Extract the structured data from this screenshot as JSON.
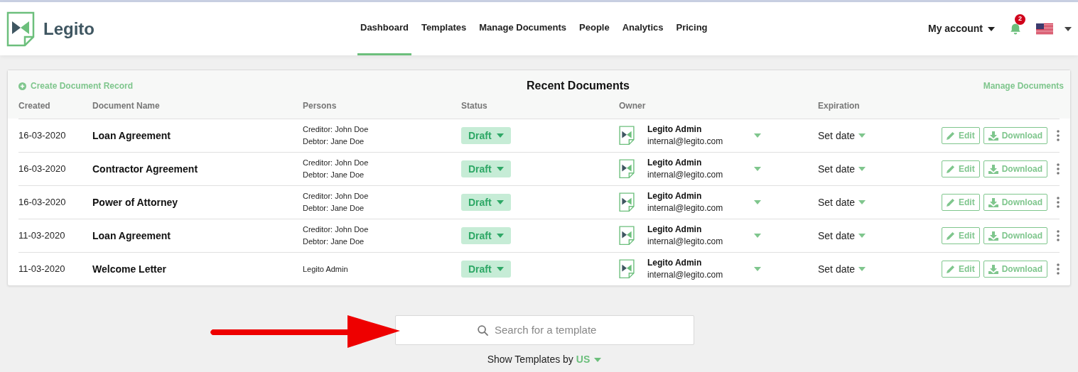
{
  "header": {
    "brand": "Legito",
    "nav": [
      {
        "label": "Dashboard",
        "selected": true
      },
      {
        "label": "Templates",
        "selected": false
      },
      {
        "label": "Manage Documents",
        "selected": false
      },
      {
        "label": "People",
        "selected": false
      },
      {
        "label": "Analytics",
        "selected": false
      },
      {
        "label": "Pricing",
        "selected": false
      }
    ],
    "account": "My account",
    "notifications": "2"
  },
  "recent": {
    "create_link": "Create Document Record",
    "title": "Recent Documents",
    "manage_link": "Manage Documents",
    "columns": [
      "Created",
      "Document Name",
      "Persons",
      "Status",
      "Owner",
      "Expiration"
    ],
    "rows": [
      {
        "created": "16-03-2020",
        "name": "Loan Agreement",
        "persons": [
          "Creditor: John Doe",
          "Debtor: Jane Doe"
        ],
        "status": "Draft",
        "owner": "Legito Admin",
        "email": "internal@legito.com",
        "expiration": "Set date",
        "edit": "Edit",
        "download": "Download"
      },
      {
        "created": "16-03-2020",
        "name": "Contractor Agreement",
        "persons": [
          "Creditor: John Doe",
          "Debtor: Jane Doe"
        ],
        "status": "Draft",
        "owner": "Legito Admin",
        "email": "internal@legito.com",
        "expiration": "Set date",
        "edit": "Edit",
        "download": "Download"
      },
      {
        "created": "16-03-2020",
        "name": "Power of Attorney",
        "persons": [
          "Creditor: John Doe",
          "Debtor: Jane Doe"
        ],
        "status": "Draft",
        "owner": "Legito Admin",
        "email": "internal@legito.com",
        "expiration": "Set date",
        "edit": "Edit",
        "download": "Download"
      },
      {
        "created": "11-03-2020",
        "name": "Loan Agreement",
        "persons": [
          "Creditor: John Doe",
          "Debtor: Jane Doe"
        ],
        "status": "Draft",
        "owner": "Legito Admin",
        "email": "internal@legito.com",
        "expiration": "Set date",
        "edit": "Edit",
        "download": "Download"
      },
      {
        "created": "11-03-2020",
        "name": "Welcome Letter",
        "persons": [
          "Legito Admin"
        ],
        "status": "Draft",
        "owner": "Legito Admin",
        "email": "internal@legito.com",
        "expiration": "Set date",
        "edit": "Edit",
        "download": "Download"
      }
    ]
  },
  "search": {
    "placeholder": "Search for a template"
  },
  "templates_by": {
    "label": "Show Templates by",
    "value": "US"
  }
}
